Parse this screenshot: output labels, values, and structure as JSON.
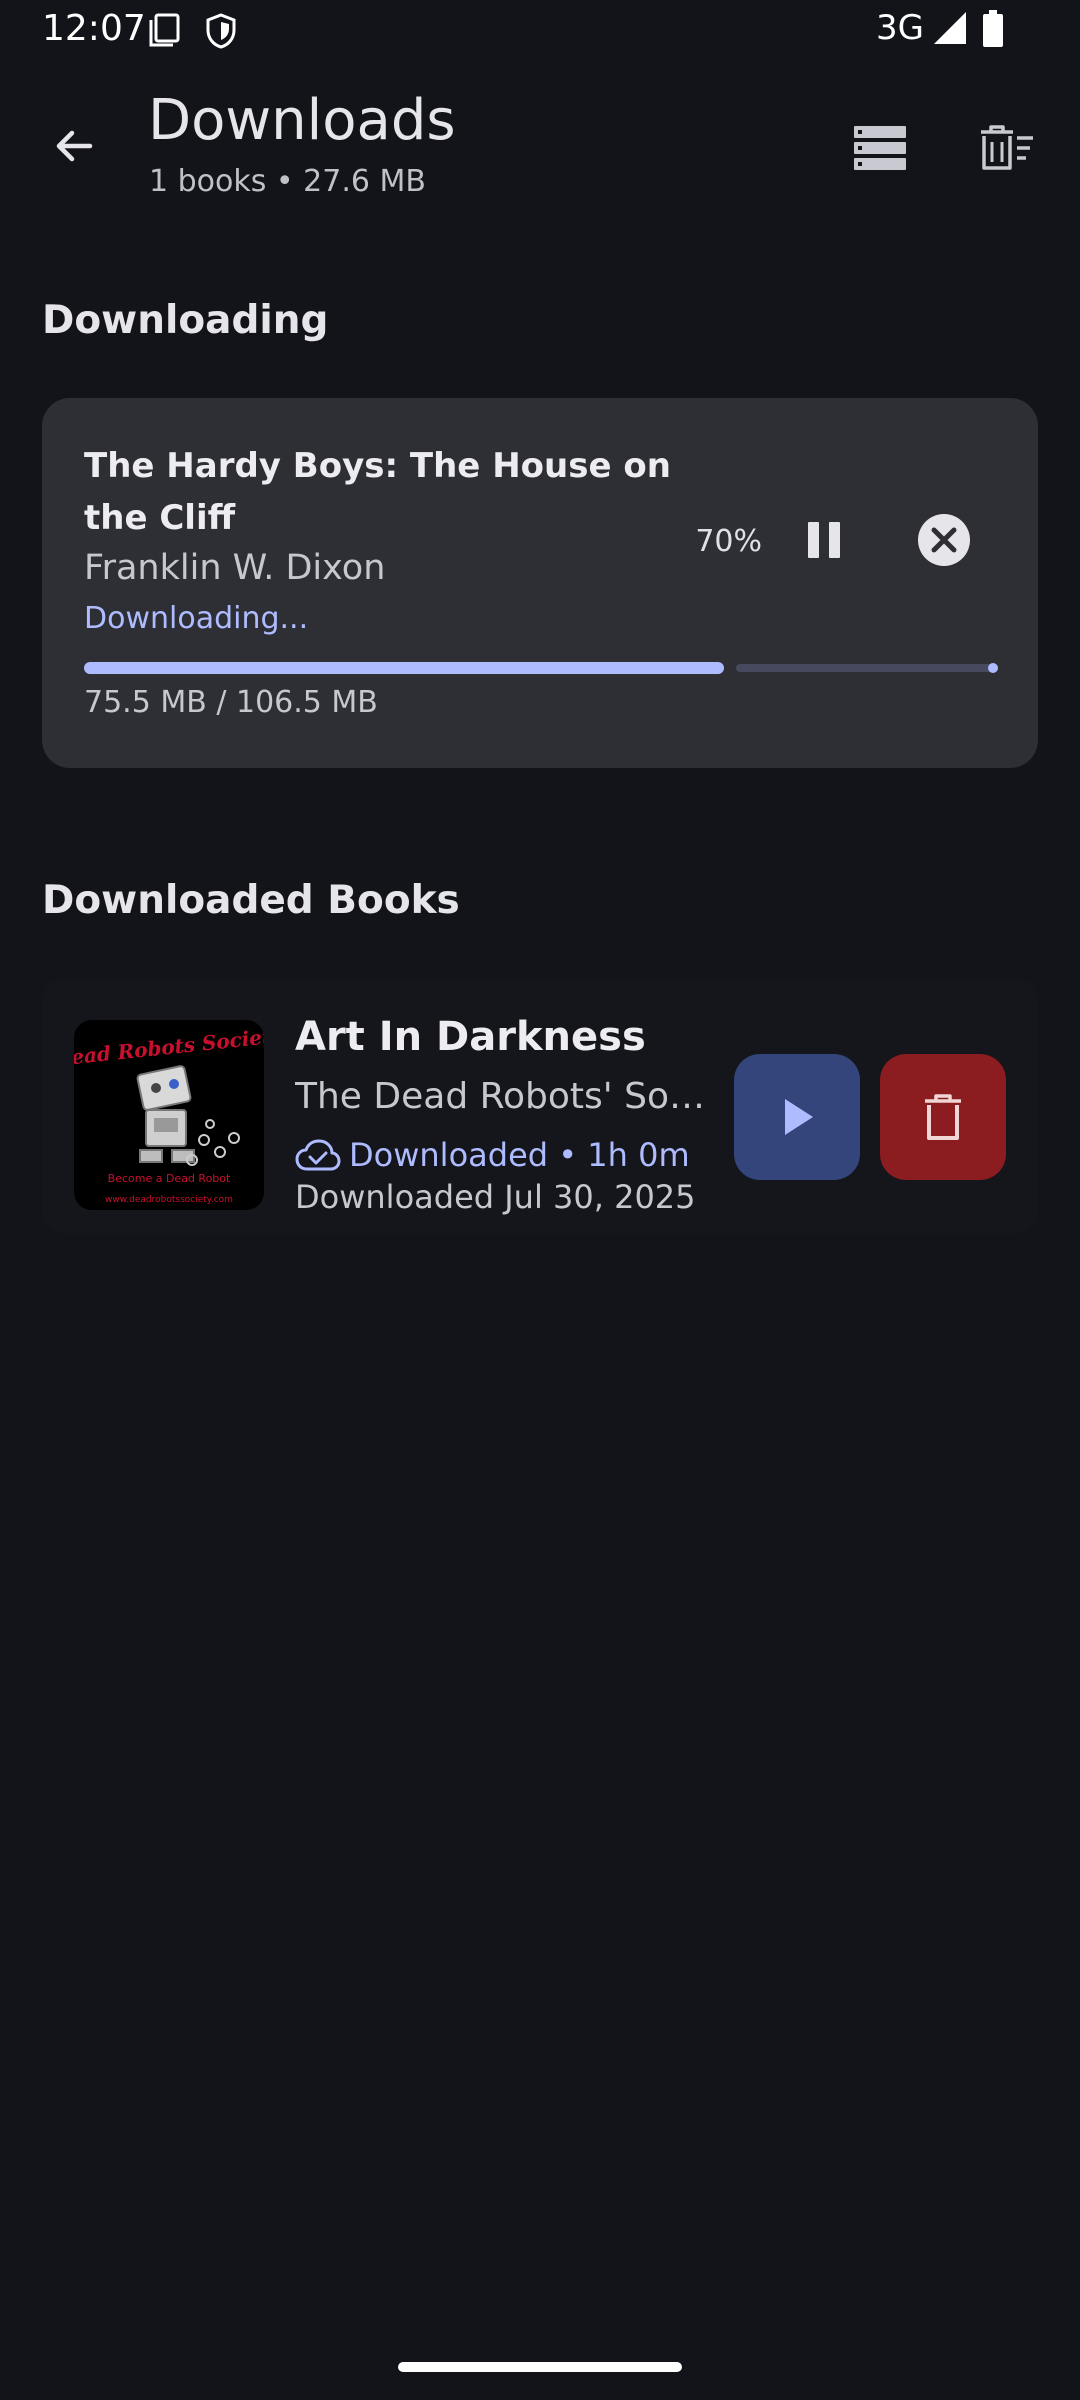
{
  "status_bar": {
    "time": "12:07",
    "network": "3G",
    "icons": [
      "sim-card-icon",
      "shield-icon",
      "signal-icon",
      "battery-icon"
    ]
  },
  "header": {
    "title": "Downloads",
    "subtitle": "1 books • 27.6 MB",
    "icons": [
      "back-arrow-icon",
      "storage-icon",
      "clear-all-icon"
    ]
  },
  "downloading": {
    "section_title": "Downloading",
    "item": {
      "title": "The Hardy Boys: The House on the Cliff",
      "author": "Franklin W. Dixon",
      "status": "Downloading...",
      "percent_label": "70%",
      "progress": 0.7,
      "size_label": "75.5 MB / 106.5 MB"
    }
  },
  "downloaded": {
    "section_title": "Downloaded Books",
    "items": [
      {
        "title": "Art In Darkness",
        "author": "The Dead Robots' Society",
        "status": "Downloaded • 1h 0m",
        "date": "Downloaded Jul 30, 2025",
        "cover_lines": [
          "Dead Robots Society",
          "Become a Dead Robot",
          "www.deadrobotssociety.com"
        ]
      }
    ]
  },
  "colors": {
    "background": "#131419",
    "card": "#2e2f35",
    "accent": "#aebcff",
    "play_button": "#33457a",
    "delete_button": "#8b1c1f"
  }
}
